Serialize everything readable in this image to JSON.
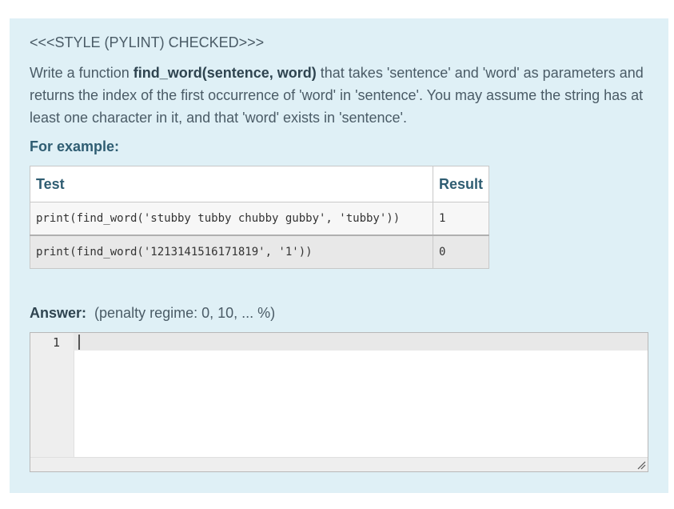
{
  "style_note": "<<<STYLE (PYLINT) CHECKED>>>",
  "question": {
    "intro": "Write a function ",
    "function_signature": "find_word(sentence, word)",
    "body": " that takes 'sentence' and 'word' as parameters and returns the index of the first occurrence of 'word' in 'sentence'. You may assume the string has at least one character in it, and that 'word' exists in 'sentence'."
  },
  "example_heading": "For example:",
  "examples_table": {
    "headers": [
      "Test",
      "Result"
    ],
    "rows": [
      {
        "test": "print(find_word('stubby tubby chubby gubby', 'tubby'))",
        "result": "1"
      },
      {
        "test": "print(find_word('1213141516171819', '1'))",
        "result": "0"
      }
    ]
  },
  "answer": {
    "label": "Answer:",
    "penalty": "(penalty regime: 0, 10, ... %)"
  },
  "editor": {
    "line_numbers": [
      "1"
    ],
    "content": ""
  }
}
